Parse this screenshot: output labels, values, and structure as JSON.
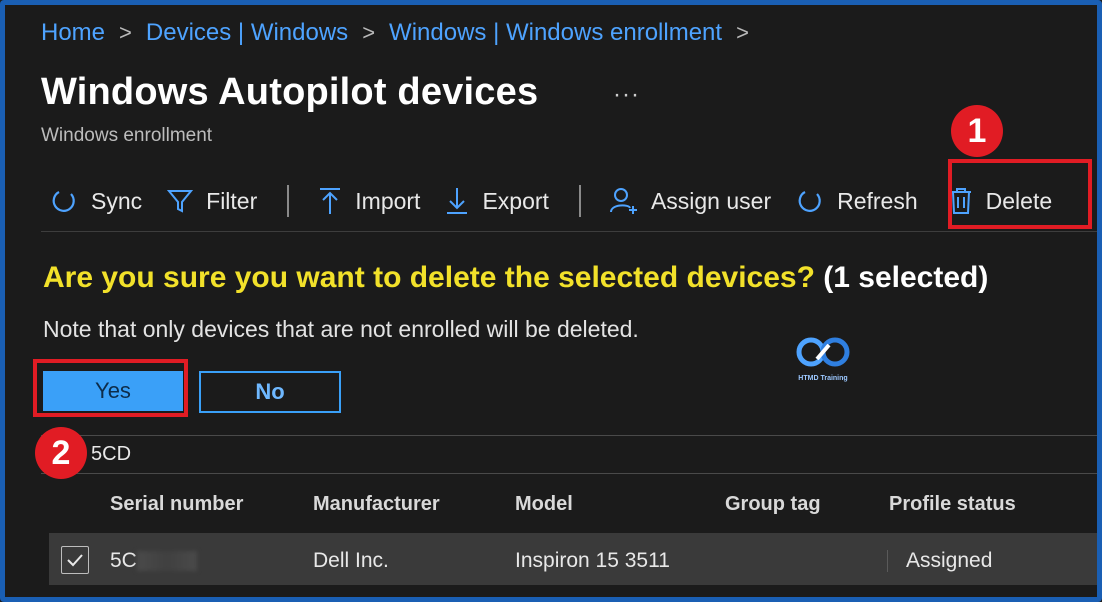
{
  "breadcrumb": {
    "items": [
      "Home",
      "Devices | Windows",
      "Windows | Windows enrollment"
    ],
    "separator": ">"
  },
  "header": {
    "title": "Windows Autopilot devices",
    "more_label": "···",
    "subtitle": "Windows enrollment"
  },
  "toolbar": {
    "sync": "Sync",
    "filter": "Filter",
    "import": "Import",
    "export": "Export",
    "assign_user": "Assign user",
    "refresh": "Refresh",
    "delete": "Delete"
  },
  "annotations": {
    "step1": "1",
    "step2": "2",
    "highlight_color": "#e11c24"
  },
  "confirm": {
    "question": "Are you sure you want to delete the selected devices?",
    "count": "(1 selected)",
    "note": "Note that only devices that are not enrolled will be deleted.",
    "yes": "Yes",
    "no": "No"
  },
  "watermark": {
    "text": "HTMD Training"
  },
  "search": {
    "value": "5CD"
  },
  "table": {
    "columns": [
      "Serial number",
      "Manufacturer",
      "Model",
      "Group tag",
      "Profile status"
    ],
    "rows": [
      {
        "selected": true,
        "serial": "5C",
        "manufacturer": "Dell Inc.",
        "model": "Inspiron 15 3511",
        "group_tag": "",
        "profile_status": "Assigned"
      }
    ]
  },
  "colors": {
    "accent": "#3aa0f8",
    "link": "#4ea3ff",
    "warning_text": "#f2e12a",
    "frame_border": "#1a5fb4"
  }
}
